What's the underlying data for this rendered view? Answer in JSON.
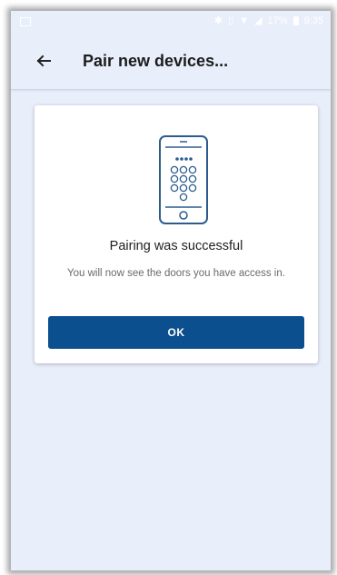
{
  "status_bar": {
    "battery_text": "17%",
    "time": "9:35",
    "icons": [
      "notification-icon",
      "bluetooth-icon",
      "vibrate-icon",
      "wifi-icon",
      "signal-icon",
      "battery-icon"
    ]
  },
  "app_bar": {
    "back_icon": "arrow-left-icon",
    "title": "Pair new devices..."
  },
  "dialog": {
    "icon": "phone-keypad-icon",
    "title": "Pairing was successful",
    "message": "You will now see the doors you have access in.",
    "ok_label": "OK"
  },
  "colors": {
    "background": "#e9eefb",
    "primary": "#0c4f8f",
    "icon_stroke": "#2c5c8f"
  }
}
